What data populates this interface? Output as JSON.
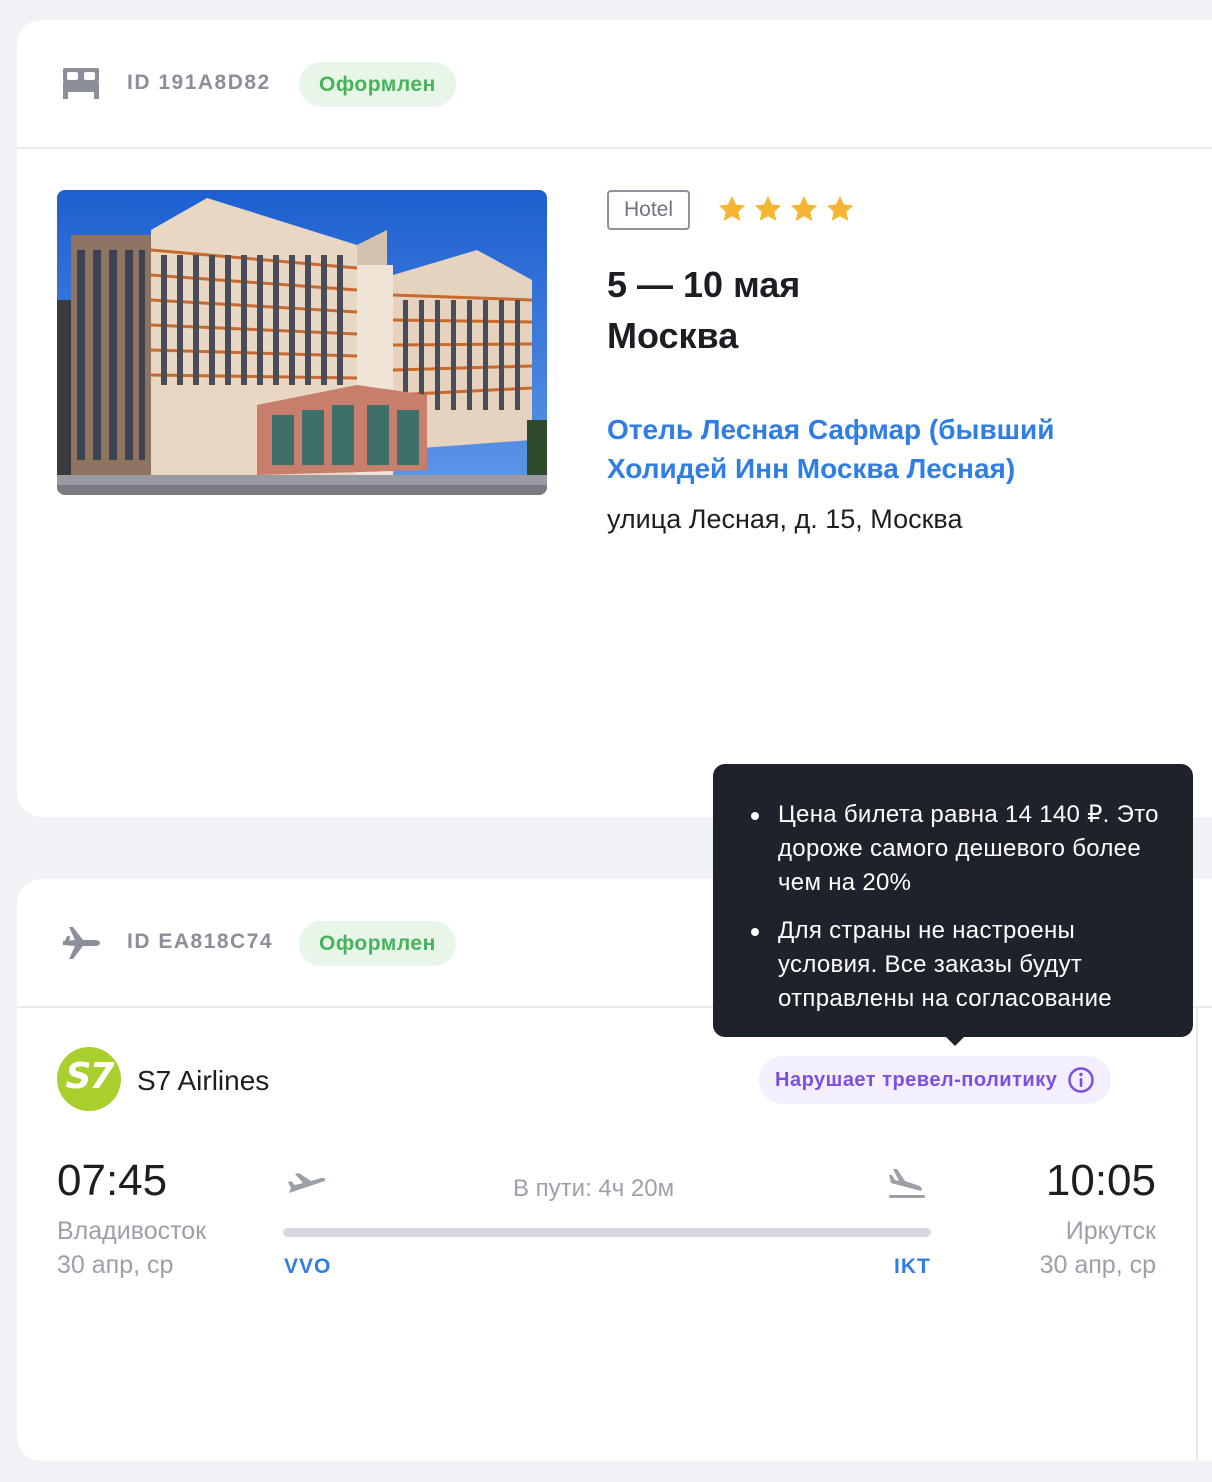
{
  "hotel_order": {
    "type_icon": "bed-icon",
    "id_text": "ID  191A8D82",
    "status": "Оформлен",
    "hotel_type": "Hotel",
    "stars": 4,
    "dates": "5 — 10 мая",
    "city": "Москва",
    "name": "Отель Лесная Сафмар (бывший Холидей Инн Москва Лесная)",
    "address": "улица Лесная, д. 15, Москва"
  },
  "flight_order": {
    "type_icon": "airplane-icon",
    "id_text": "ID  EA818C74",
    "status": "Оформлен",
    "airline_logo_text": "S7",
    "airline": "S7 Airlines",
    "policy_badge": "Нарушает тревел-политику",
    "departure": {
      "time": "07:45",
      "city": "Владивосток",
      "date": "30 апр, ср",
      "code": "VVO"
    },
    "arrival": {
      "time": "10:05",
      "city": "Иркутск",
      "date": "30 апр, ср",
      "code": "IKT"
    },
    "duration": "В пути: 4ч 20м"
  },
  "tooltip": {
    "items": [
      "Цена билета равна 14 140 ₽. Это дороже самого дешевого более чем на 20%",
      "Для страны не настроены условия. Все заказы будут отправлены на согласование"
    ]
  },
  "colors": {
    "status_green": "#47b35a",
    "status_bg": "#e8f6ea",
    "link_blue": "#2f7ee6",
    "policy_purple": "#7c4ee4",
    "policy_bg": "#f3efff",
    "star": "#f5b731",
    "tooltip_bg": "#1e232b",
    "s7_green": "#a8cf2e"
  }
}
